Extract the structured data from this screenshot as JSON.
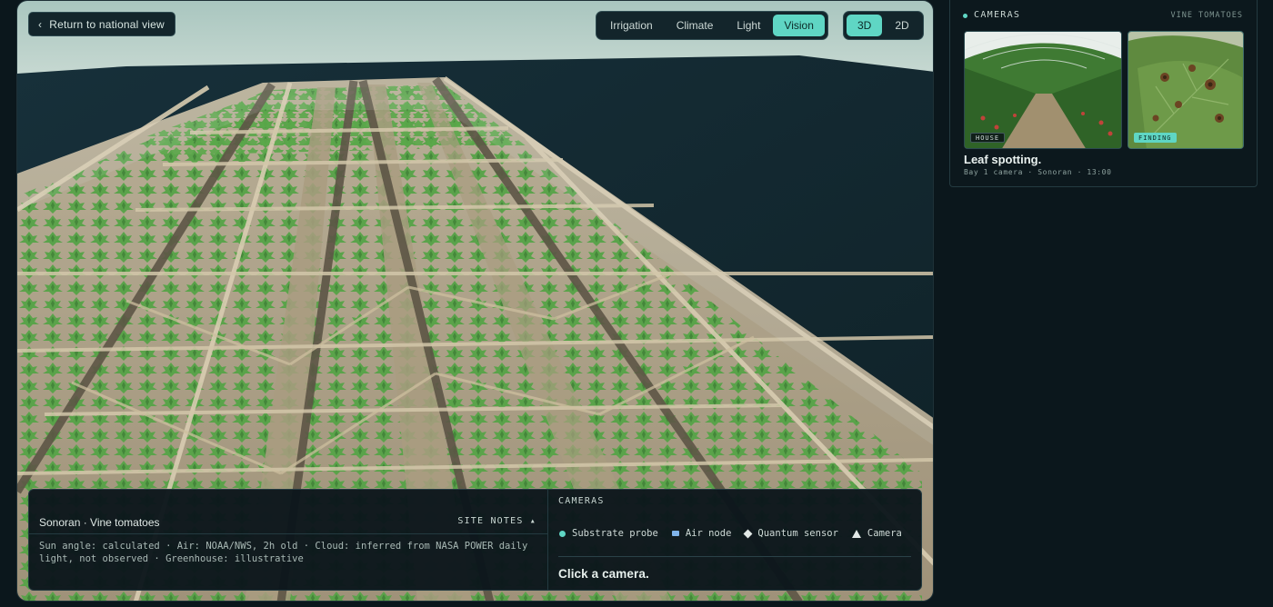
{
  "viewport": {
    "back_label": "Return to national view",
    "layer_tabs": [
      {
        "label": "Irrigation",
        "active": false
      },
      {
        "label": "Climate",
        "active": false
      },
      {
        "label": "Light",
        "active": false
      },
      {
        "label": "Vision",
        "active": true
      }
    ],
    "view_modes": [
      {
        "label": "3D",
        "active": true
      },
      {
        "label": "2D",
        "active": false
      }
    ]
  },
  "info_panel": {
    "site_title": "Sonoran · Vine tomatoes",
    "site_notes_label": "SITE NOTES ▴",
    "notes": "Sun angle: calculated · Air: NOAA/NWS, 2h old · Cloud: inferred from NASA POWER daily light, not observed · Greenhouse: illustrative",
    "cameras_heading": "CAMERAS",
    "legend": [
      {
        "label": "Substrate probe",
        "icon": "dot-icon"
      },
      {
        "label": "Air node",
        "icon": "square-icon"
      },
      {
        "label": "Quantum sensor",
        "icon": "diamond-icon"
      },
      {
        "label": "Camera",
        "icon": "triangle-icon"
      }
    ],
    "prompt": "Click a camera."
  },
  "camera_card": {
    "heading": "CAMERAS",
    "crop": "VINE TOMATOES",
    "thumbs": [
      {
        "tag": "HOUSE",
        "icon": "greenhouse-photo"
      },
      {
        "tag": "FINDING",
        "icon": "leaf-spot-photo"
      }
    ],
    "title": "Leaf spotting.",
    "meta": "Bay 1 camera · Sonoran · 13:00"
  },
  "colors": {
    "accent": "#5fd6c4",
    "background": "#0b171c",
    "panel": "#13252b",
    "air_node": "#7fb3ea"
  }
}
